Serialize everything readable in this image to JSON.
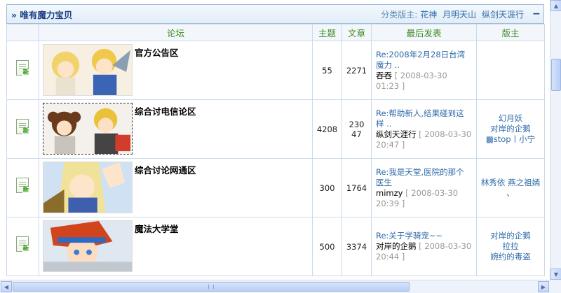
{
  "category": {
    "title": "» 唯有魔力宝贝",
    "moderators_label": "分类版主:",
    "moderators": [
      "花神",
      "月明天山",
      "纵剑天涯行"
    ],
    "collapse_symbol": "−"
  },
  "columns": {
    "forum": "论坛",
    "topics": "主题",
    "posts": "文章",
    "last_post": "最后发表",
    "moderators": "版主"
  },
  "forums": [
    {
      "name": "官方公告区",
      "topics": "55",
      "posts": "2271",
      "last_title": "Re:2008年2月28日台湾魔力 ..",
      "last_author": "吞吞",
      "last_time": "[ 2008-03-30 01:23 ]",
      "moderators": "",
      "new_badge": "新"
    },
    {
      "name": "综合讨电信论区",
      "topics": "4208",
      "posts": "23047",
      "last_title": "Re:帮助新人,结果碰到这样 ..",
      "last_author": "纵剑天涯行",
      "last_time": "[ 2008-03-30 20:47 ]",
      "moderators": "幻月妖\n对岸的企鹅\n▩stop丨小宁",
      "new_badge": "新"
    },
    {
      "name": "综合讨论网通区",
      "topics": "300",
      "posts": "1764",
      "last_title": "Re:我是天堂,医院的那个医生",
      "last_author": "mimzy",
      "last_time": "[ 2008-03-30 20:39 ]",
      "moderators": "林秀依  燕之祖嫣    、",
      "new_badge": "新"
    },
    {
      "name": "魔法大学堂",
      "topics": "500",
      "posts": "3374",
      "last_title": "Re:关于学骑宠~~",
      "last_author": "对岸的企鹅",
      "last_time": "[ 2008-03-30 20:44 ]",
      "moderators": "对岸的企鹅\n拉拉\n婉约的毒盗",
      "new_badge": "新"
    }
  ],
  "scrollbar": {
    "up": "▲",
    "down": "▼",
    "left": "◀",
    "right": "▶"
  },
  "colors": {
    "header_text": "#1d3f86",
    "column_text": "#3d8a22",
    "link": "#2e6aa9",
    "border": "#c9daeb"
  }
}
